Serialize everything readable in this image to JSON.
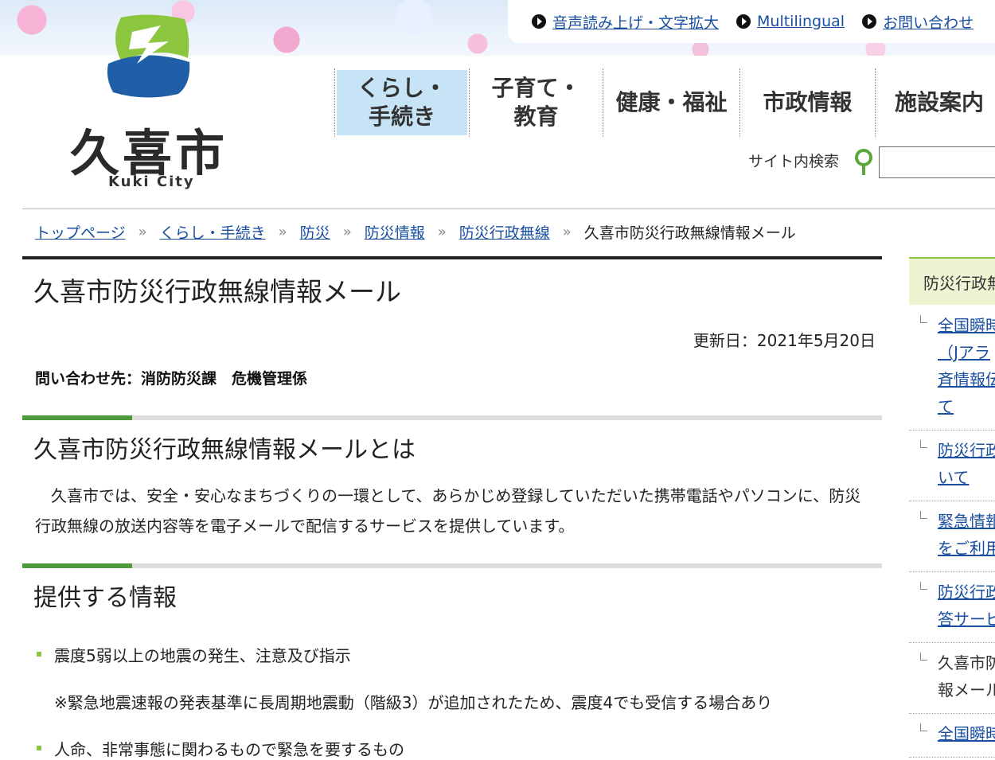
{
  "utility": {
    "links": [
      "音声読み上げ・文字拡大",
      "Multilingual",
      "お問い合わせ"
    ]
  },
  "logo": {
    "kanji": "久喜市",
    "english": "Kuki City",
    "colors": {
      "green": "#8cc63f",
      "blue": "#1f5fa8"
    }
  },
  "nav": {
    "items": [
      {
        "line1": "くらし・",
        "line2": "手続き",
        "active": true
      },
      {
        "line1": "子育て・",
        "line2": "教育",
        "active": false
      },
      {
        "line1": "健康・福祉",
        "line2": "",
        "active": false
      },
      {
        "line1": "市政情報",
        "line2": "",
        "active": false
      },
      {
        "line1": "施設案内",
        "line2": "",
        "active": false
      }
    ]
  },
  "search": {
    "label": "サイト内検索",
    "value": "",
    "icon": "magnifier-icon"
  },
  "breadcrumb": {
    "items": [
      "トップページ",
      "くらし・手続き",
      "防災",
      "防災情報",
      "防災行政無線"
    ],
    "separator": "»",
    "current": "久喜市防災行政無線情報メール"
  },
  "page": {
    "title": "久喜市防災行政無線情報メール",
    "updated": "更新日：2021年5月20日",
    "contact": "問い合わせ先：消防防災課　危機管理係"
  },
  "sections": [
    {
      "title": "久喜市防災行政無線情報メールとは",
      "paragraph": "　久喜市では、安全・安心なまちづくりの一環として、あらかじめ登録していただいた携帯電話やパソコンに、防災行政無線の放送内容等を電子メールで配信するサービスを提供しています。"
    },
    {
      "title": "提供する情報",
      "bullets": [
        "震度5弱以上の地震の発生、注意及び指示",
        "人命、非常事態に関わるもので緊急を要するもの"
      ],
      "note": "※緊急地震速報の発表基準に長周期地震動（階級3）が追加されたため、震度4でも受信する場合あり"
    }
  ],
  "sidebar": {
    "heading": "防災行政無線",
    "items": [
      {
        "lines": [
          "全国瞬時",
          "（Jアラ",
          "斉情報伝",
          "て"
        ],
        "link": true
      },
      {
        "lines": [
          "防災行政",
          "いて"
        ],
        "link": true
      },
      {
        "lines": [
          "緊急情報",
          "をご利用"
        ],
        "link": true
      },
      {
        "lines": [
          "防災行政",
          "答サービ"
        ],
        "link": true
      },
      {
        "lines": [
          "久喜市防",
          "報メール"
        ],
        "link": false
      },
      {
        "lines": [
          "全国瞬時"
        ],
        "link": true
      }
    ]
  },
  "colors": {
    "accent_green": "#4e9b3e",
    "bullet_green": "#8cc63f",
    "nav_active": "#c7e4f7",
    "link": "#1a4fa0"
  }
}
